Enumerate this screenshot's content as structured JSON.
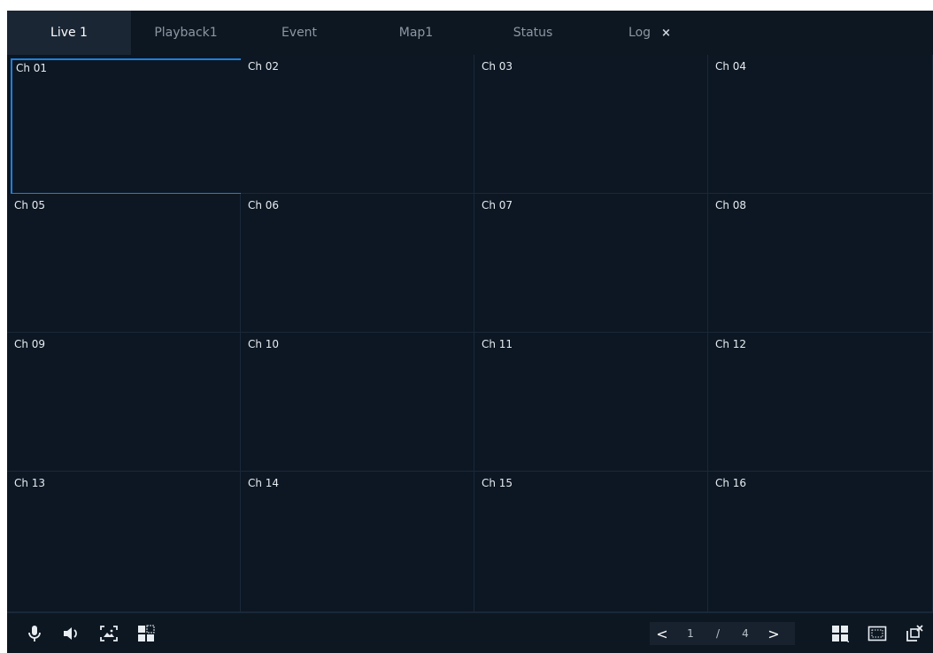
{
  "tabs": [
    {
      "label": "Live 1",
      "active": true
    },
    {
      "label": "Playback1",
      "active": false
    },
    {
      "label": "Event",
      "active": false
    },
    {
      "label": "Map1",
      "active": false
    },
    {
      "label": "Status",
      "active": false
    },
    {
      "label": "Log",
      "active": false,
      "close": "×"
    }
  ],
  "channels": [
    "Ch 01",
    "Ch 02",
    "Ch 03",
    "Ch 04",
    "Ch 05",
    "Ch 06",
    "Ch 07",
    "Ch 08",
    "Ch 09",
    "Ch 10",
    "Ch 11",
    "Ch 12",
    "Ch 13",
    "Ch 14",
    "Ch 15",
    "Ch 16"
  ],
  "selected_channel": "Ch 01",
  "pager": {
    "prev": "<",
    "current": "1",
    "separator": "/",
    "total": "4",
    "next": ">"
  },
  "colors": {
    "accent": "#1d7fe0",
    "background": "#0e1823",
    "active_tab": "#1a2634"
  },
  "icons": {
    "left": [
      "microphone-icon",
      "speaker-icon",
      "capture-icon",
      "layout-sequence-icon"
    ],
    "right": [
      "split-layout-icon",
      "aspect-ratio-icon",
      "popout-close-icon"
    ]
  }
}
